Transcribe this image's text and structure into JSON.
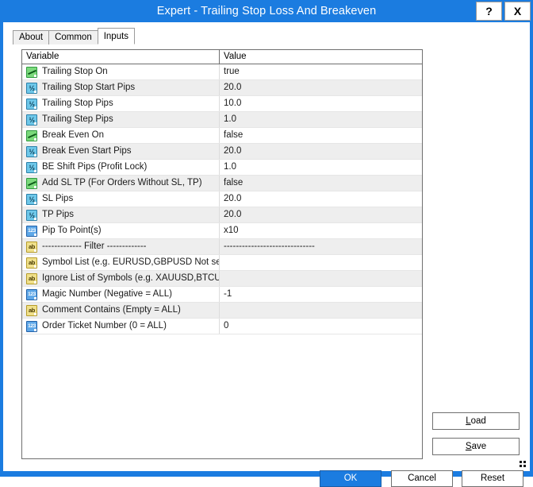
{
  "window": {
    "title": "Expert - Trailing Stop Loss And Breakeven",
    "help_label": "?",
    "close_label": "X"
  },
  "tabs": [
    {
      "label": "About",
      "active": false
    },
    {
      "label": "Common",
      "active": false
    },
    {
      "label": "Inputs",
      "active": true
    }
  ],
  "grid": {
    "headers": {
      "variable": "Variable",
      "value": "Value"
    },
    "rows": [
      {
        "icon": "bool-icon",
        "type": "bool",
        "name": "Trailing Stop On",
        "value": "true"
      },
      {
        "icon": "double-icon",
        "type": "dbl",
        "name": "Trailing Stop Start Pips",
        "value": "20.0"
      },
      {
        "icon": "double-icon",
        "type": "dbl",
        "name": "Trailing Stop Pips",
        "value": "10.0"
      },
      {
        "icon": "double-icon",
        "type": "dbl",
        "name": "Trailing Step Pips",
        "value": "1.0"
      },
      {
        "icon": "bool-icon",
        "type": "bool",
        "name": "Break Even On",
        "value": "false"
      },
      {
        "icon": "double-icon",
        "type": "dbl",
        "name": "Break Even Start Pips",
        "value": "20.0"
      },
      {
        "icon": "double-icon",
        "type": "dbl",
        "name": "BE Shift Pips (Profit Lock)",
        "value": "1.0"
      },
      {
        "icon": "bool-icon",
        "type": "bool",
        "name": "Add SL TP (For Orders Without SL, TP)",
        "value": "false"
      },
      {
        "icon": "double-icon",
        "type": "dbl",
        "name": "SL Pips",
        "value": "20.0"
      },
      {
        "icon": "double-icon",
        "type": "dbl",
        "name": "TP Pips",
        "value": "20.0"
      },
      {
        "icon": "int-icon",
        "type": "int",
        "name": "Pip To Point(s)",
        "value": "x10"
      },
      {
        "icon": "string-icon",
        "type": "str",
        "name": "------------- Filter -------------",
        "value": "------------------------------"
      },
      {
        "icon": "string-icon",
        "type": "str",
        "name": "Symbol List (e.g. EURUSD,GBPUSD Not set...",
        "value": ""
      },
      {
        "icon": "string-icon",
        "type": "str",
        "name": "Ignore List of Symbols (e.g. XAUUSD,BTCU...",
        "value": ""
      },
      {
        "icon": "int-icon",
        "type": "int",
        "name": "Magic Number (Negative = ALL)",
        "value": "-1"
      },
      {
        "icon": "string-icon",
        "type": "str",
        "name": "Comment Contains (Empty = ALL)",
        "value": ""
      },
      {
        "icon": "int-icon",
        "type": "int",
        "name": "Order Ticket Number (0 = ALL)",
        "value": "0"
      }
    ]
  },
  "side_buttons": {
    "load": {
      "mnemonic": "L",
      "rest": "oad"
    },
    "save": {
      "mnemonic": "S",
      "rest": "ave"
    }
  },
  "bottom_buttons": {
    "ok": "OK",
    "cancel": "Cancel",
    "reset": "Reset"
  },
  "colors": {
    "title_bar": "#1b7ce0",
    "accent": "#1b7ce0",
    "row_alt": "#eeeeee",
    "bool_icon": "#7bd97b",
    "double_icon": "#6ec8ea",
    "int_icon": "#5fa8e8",
    "string_icon": "#f0e08a"
  }
}
